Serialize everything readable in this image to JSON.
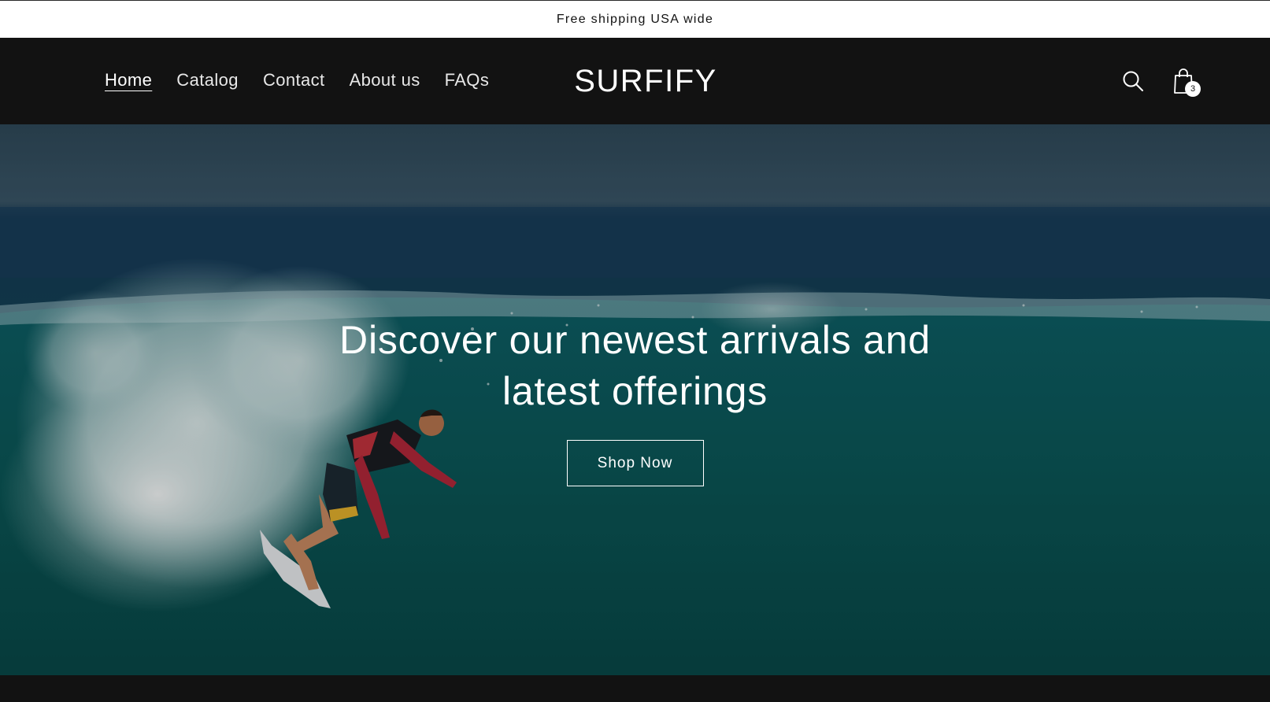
{
  "announcement": {
    "text": "Free shipping USA wide"
  },
  "header": {
    "nav": [
      {
        "label": "Home",
        "active": true
      },
      {
        "label": "Catalog",
        "active": false
      },
      {
        "label": "Contact",
        "active": false
      },
      {
        "label": "About us",
        "active": false
      },
      {
        "label": "FAQs",
        "active": false
      }
    ],
    "logo": "SURFIFY",
    "search_icon": "search-icon",
    "cart_icon": "shopping-bag-icon",
    "cart_count": "3"
  },
  "hero": {
    "title": "Discover our newest arrivals and latest offerings",
    "button_label": "Shop Now",
    "image_subject": "surfer-riding-wave"
  },
  "colors": {
    "header_bg": "#121212",
    "announcement_bg": "#ffffff",
    "text_light": "#ffffff",
    "ocean": "#0a4a4c"
  }
}
